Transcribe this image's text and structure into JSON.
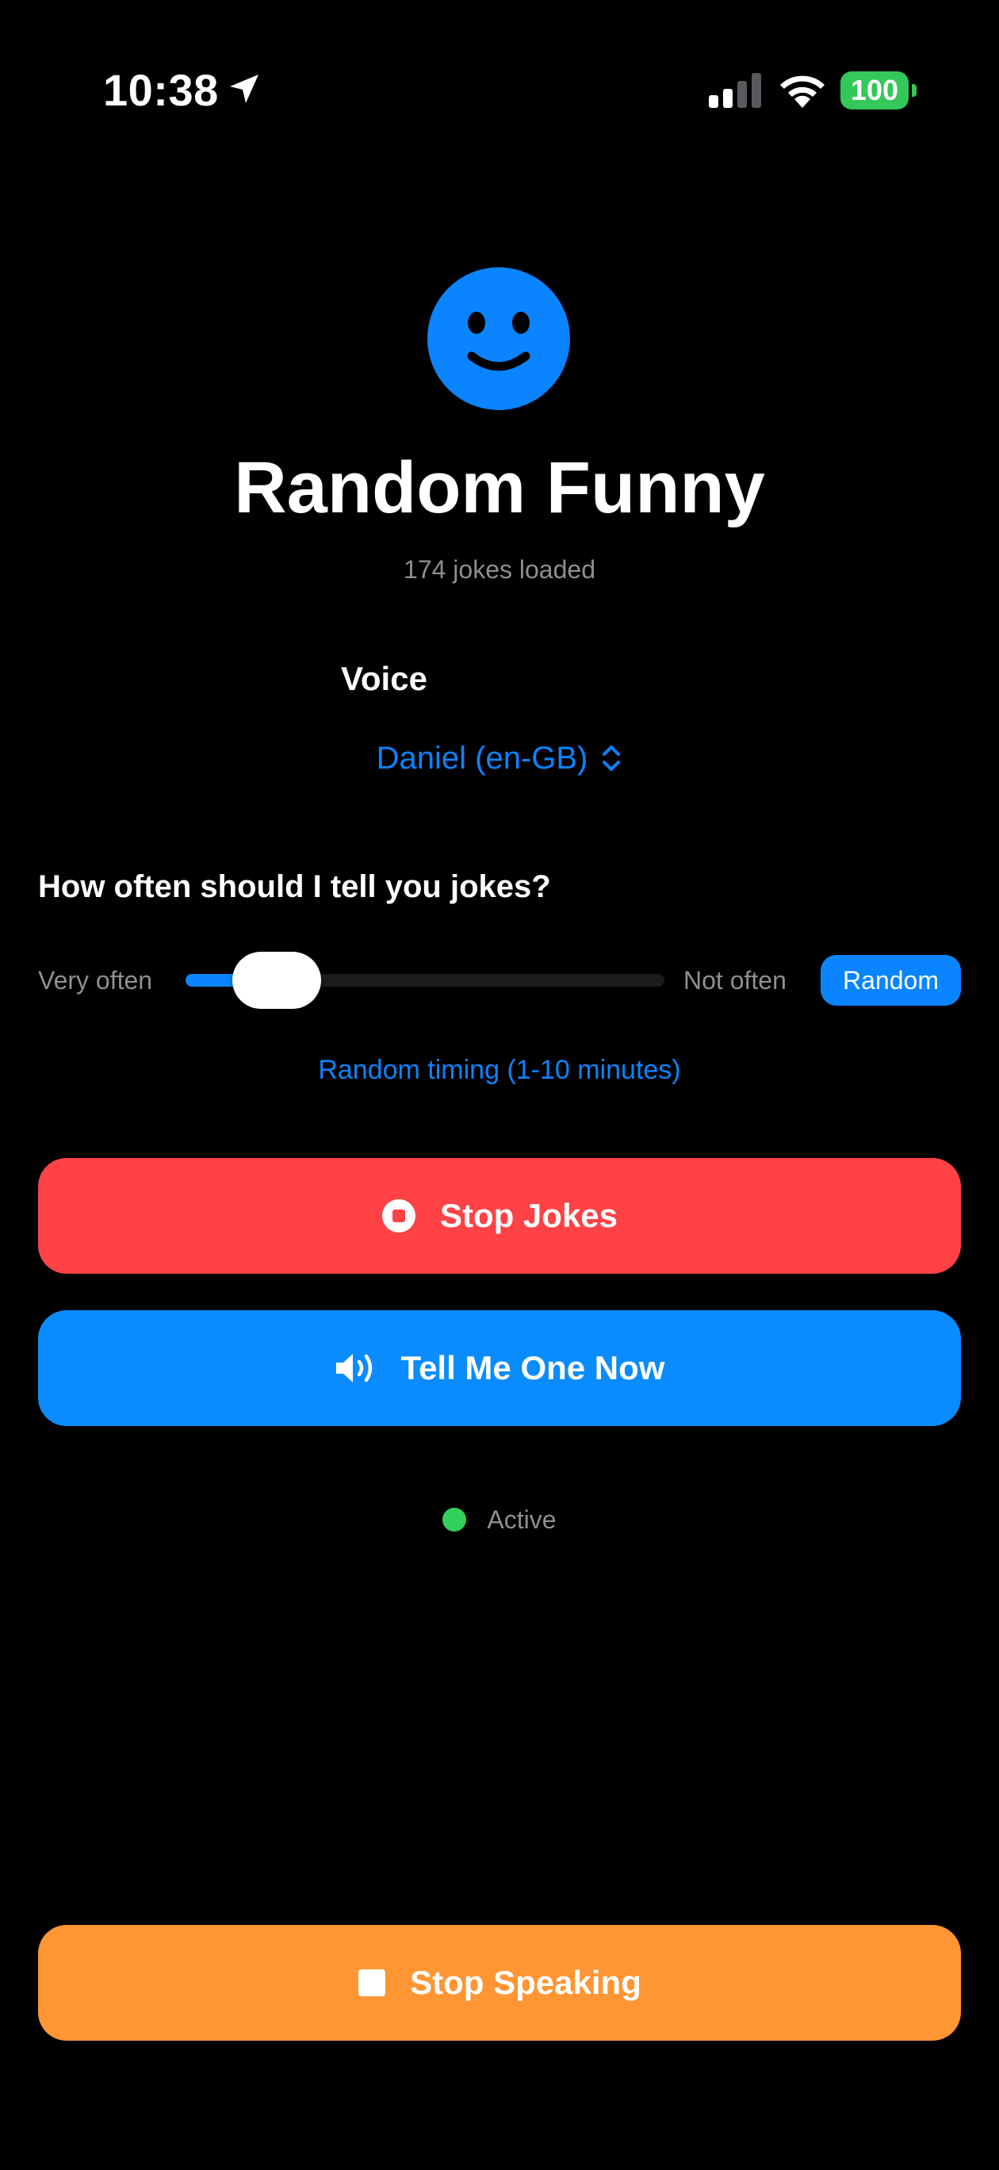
{
  "status_bar": {
    "time": "10:38",
    "battery": "100",
    "location_icon": "location-arrow-icon",
    "signal_icon": "cellular-signal-icon",
    "wifi_icon": "wifi-icon"
  },
  "header": {
    "icon": "smiley-face-icon",
    "title": "Random Funny",
    "subtitle": "174 jokes loaded"
  },
  "voice": {
    "label": "Voice",
    "selected": "Daniel (en-GB)",
    "picker_icon": "chevron-up-down-icon"
  },
  "frequency": {
    "heading": "How often should I tell you jokes?",
    "min_label": "Very often",
    "max_label": "Not often",
    "slider_value": 0.05,
    "random_label": "Random",
    "caption": "Random timing (1-10 minutes)"
  },
  "actions": {
    "stop_jokes": "Stop Jokes",
    "tell_one": "Tell Me One Now",
    "stop_speaking": "Stop Speaking"
  },
  "status": {
    "text": "Active"
  },
  "colors": {
    "accent": "#0a84ff",
    "stop_jokes": "#ff4245",
    "tell_one": "#0a8cff",
    "stop_speaking": "#ff9533",
    "active": "#30d158",
    "battery": "#34c759"
  }
}
